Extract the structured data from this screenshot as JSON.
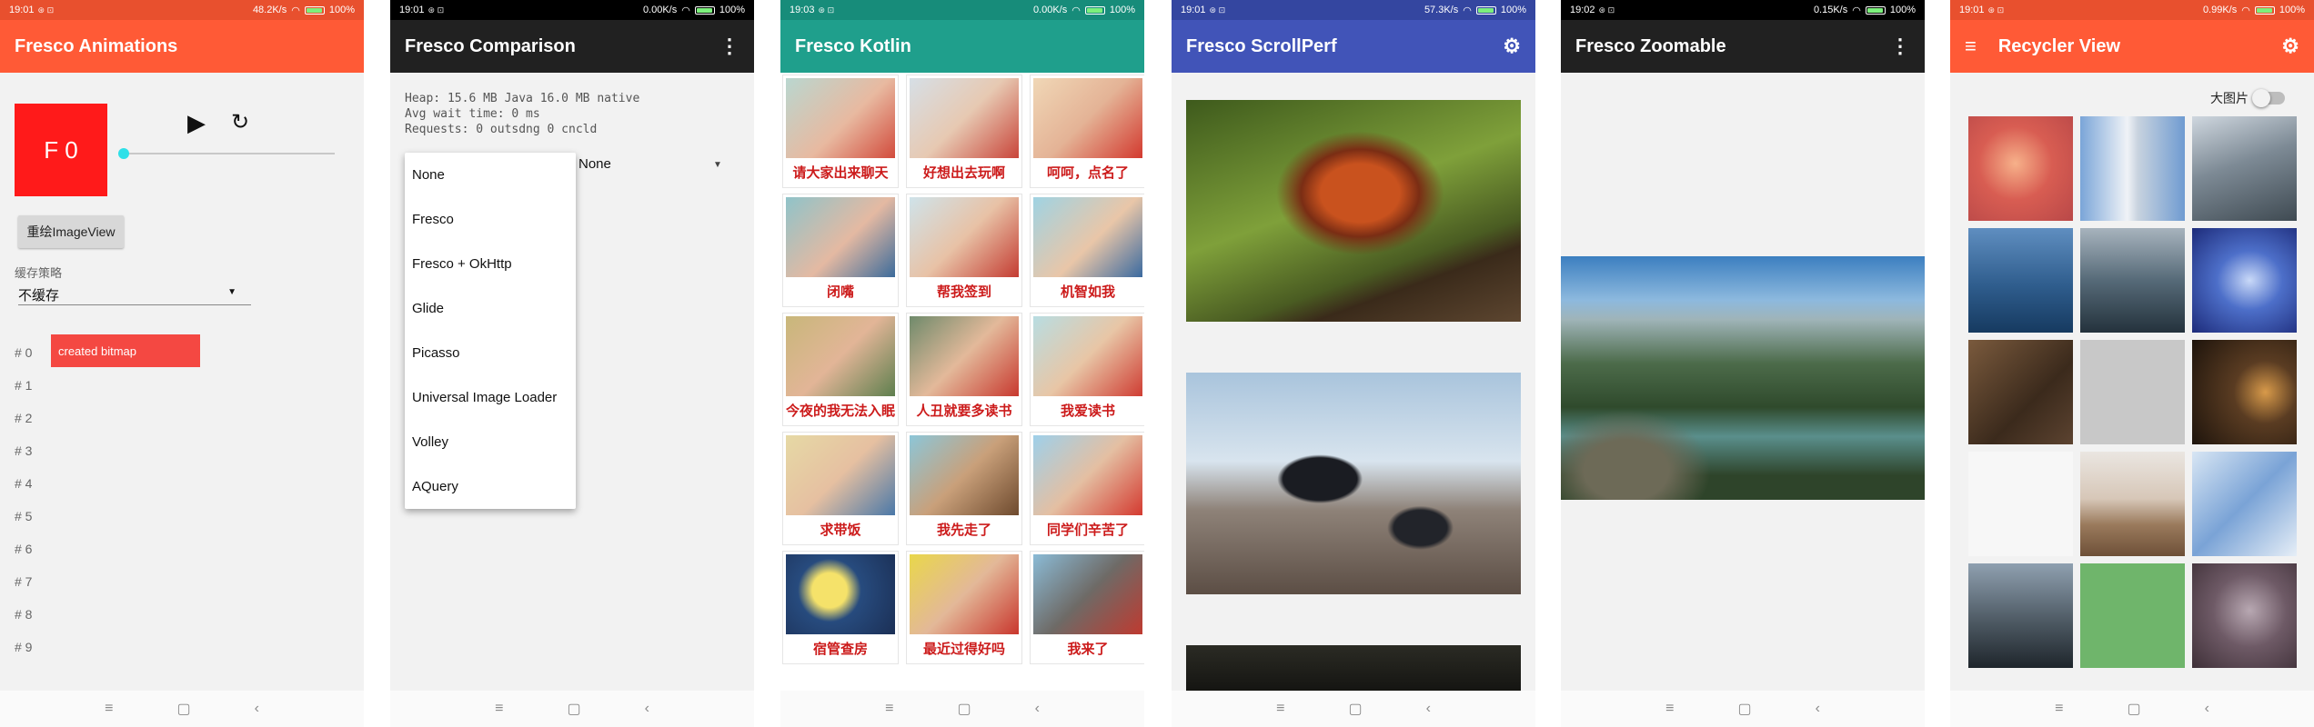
{
  "status": {
    "net_icons": "⊛ ⊡",
    "screens": [
      {
        "time": "19:01",
        "speed": "48.2K/s",
        "battery": "100%"
      },
      {
        "time": "19:01",
        "speed": "0.00K/s",
        "battery": "100%"
      },
      {
        "time": "19:03",
        "speed": "0.00K/s",
        "battery": "100%"
      },
      {
        "time": "19:01",
        "speed": "57.3K/s",
        "battery": "100%"
      },
      {
        "time": "19:02",
        "speed": "0.15K/s",
        "battery": "100%"
      },
      {
        "time": "19:01",
        "speed": "0.99K/s",
        "battery": "100%"
      }
    ]
  },
  "colors": {
    "orange": "#ff5a36",
    "dark": "#212121",
    "teal": "#1f9f8c",
    "indigo": "#4154b8"
  },
  "icons": {
    "overflow": "⋮",
    "gear": "⚙",
    "menu": "≡",
    "play": "▶",
    "replay": "↻",
    "nav_menu": "≡",
    "nav_home": "▢",
    "nav_back": "‹"
  },
  "animations": {
    "title": "Fresco Animations",
    "frame_label": "F 0",
    "redraw_button": "重绘ImageView",
    "cache_label": "缓存策略",
    "cache_value": "不缓存",
    "rows": [
      "# 0",
      "# 1",
      "# 2",
      "# 3",
      "# 4",
      "# 5",
      "# 6",
      "# 7",
      "# 8",
      "# 9"
    ],
    "bitmap_label": "created bitmap"
  },
  "comparison": {
    "title": "Fresco Comparison",
    "stats": [
      "Heap: 15.6 MB Java 16.0 MB native",
      "Avg wait time: 0 ms",
      "Requests: 0 outsdng 0 cncld"
    ],
    "selected": "None",
    "options": [
      "None",
      "Fresco",
      "Fresco + OkHttp",
      "Glide",
      "Picasso",
      "Universal Image Loader",
      "Volley",
      "AQuery"
    ]
  },
  "kotlin": {
    "title": "Fresco Kotlin",
    "captions": [
      "请大家出来聊天",
      "好想出去玩啊",
      "呵呵，点名了",
      "闭嘴",
      "帮我签到",
      "机智如我",
      "今夜的我无法入眠",
      "人丑就要多读书",
      "我爱读书",
      "求带饭",
      "我先走了",
      "同学们辛苦了",
      "宿管查房",
      "最近过得好吗",
      "我来了"
    ]
  },
  "scrollperf": {
    "title": "Fresco ScrollPerf"
  },
  "zoomable": {
    "title": "Fresco Zoomable"
  },
  "recycler": {
    "title": "Recycler View",
    "toggle_label": "大图片"
  }
}
